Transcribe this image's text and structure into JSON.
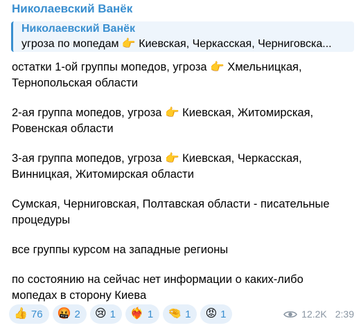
{
  "message": {
    "sender": "Николаевский Ванёк",
    "quote": {
      "author": "Николаевский Ванёк",
      "text": "угроза по мопедам 👉 Киевская, Черкасская, Черниговска..."
    },
    "lines": [
      "остатки 1-ой группы мопедов, угроза 👉 Хмельницкая, Тернопольская области",
      "2-ая группа мопедов, угроза 👉 Киевская, Житомирская, Ровенская области",
      "3-ая группа мопедов, угроза 👉 Киевская, Черкасская, Винницкая, Житомирская области",
      "Сумская, Черниговская, Полтавская области - писательные процедуры",
      "все группы курсом на западные регионы",
      "по состоянию на сейчас нет информации о каких-либо мопедах в сторону Киева"
    ],
    "reactions": [
      {
        "icon": "👍",
        "icon_name": "thumbs-up-icon",
        "count": "76"
      },
      {
        "icon": "🤬",
        "icon_name": "cursing-face-icon",
        "count": "2"
      },
      {
        "icon": "😢",
        "icon_name": "crying-face-icon",
        "count": "1"
      },
      {
        "icon": "❤️‍🔥",
        "icon_name": "heart-on-fire-icon",
        "count": "1"
      },
      {
        "icon": "🤏",
        "icon_name": "pinching-hand-icon",
        "count": "1"
      },
      {
        "icon": "😡",
        "icon_name": "angry-face-icon",
        "count": "1"
      }
    ],
    "views": "12.2K",
    "time": "2:39"
  },
  "colors": {
    "accent": "#3a8fd0",
    "quote_bg": "#eef5fc",
    "chip_bg": "#e6f0fa",
    "meta": "#8a96a3"
  }
}
